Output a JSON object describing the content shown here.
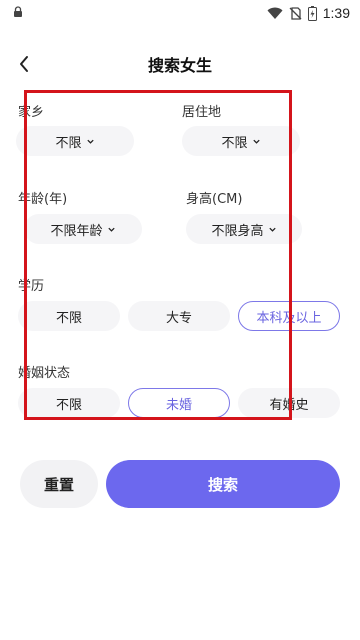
{
  "status_bar": {
    "time": "1:39"
  },
  "header": {
    "title": "搜索女生"
  },
  "filters": {
    "hometown": {
      "label": "家乡",
      "value": "不限"
    },
    "residence": {
      "label": "居住地",
      "value": "不限"
    },
    "age": {
      "label": "年龄(年)",
      "value": "不限年龄"
    },
    "height": {
      "label": "身高(CM)",
      "value": "不限身高"
    },
    "education": {
      "label": "学历",
      "options": [
        "不限",
        "大专",
        "本科及以上"
      ],
      "selected": "本科及以上"
    },
    "marital": {
      "label": "婚姻状态",
      "options": [
        "不限",
        "未婚",
        "有婚史"
      ],
      "selected": "未婚"
    }
  },
  "actions": {
    "reset_label": "重置",
    "search_label": "搜索"
  },
  "colors": {
    "accent": "#6c68ee",
    "highlight_border": "#d4141b",
    "pill_bg": "#f5f5f7"
  }
}
